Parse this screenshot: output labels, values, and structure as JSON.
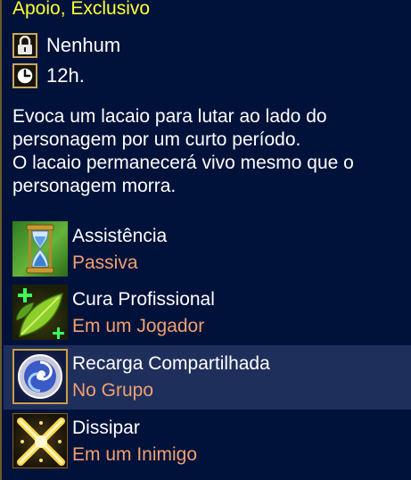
{
  "title": "Apoio, Exclusivo",
  "info": {
    "lock_icon": "lock-icon",
    "lock_text": "Nenhum",
    "clock_icon": "clock-icon",
    "duration_text": "12h."
  },
  "description": {
    "line1": "Evoca um lacaio para lutar ao lado do",
    "line2": "personagem por um curto período.",
    "line3": "O lacaio permanecerá vivo mesmo que o",
    "line4": "personagem morra."
  },
  "skills": [
    {
      "name": "Assistência",
      "target": "Passiva",
      "icon": "hourglass-icon"
    },
    {
      "name": "Cura Profissional",
      "target": "Em um Jogador",
      "icon": "leaf-heal-icon"
    },
    {
      "name": "Recarga Compartilhada",
      "target": "No Grupo",
      "icon": "swirl-orb-icon"
    },
    {
      "name": "Dissipar",
      "target": "Em um Inimigo",
      "icon": "cross-burst-icon"
    }
  ],
  "colors": {
    "title": "#ffff33",
    "target_text": "#f0a070",
    "background": "#00123a",
    "selected_row": "#1f2f5c"
  }
}
